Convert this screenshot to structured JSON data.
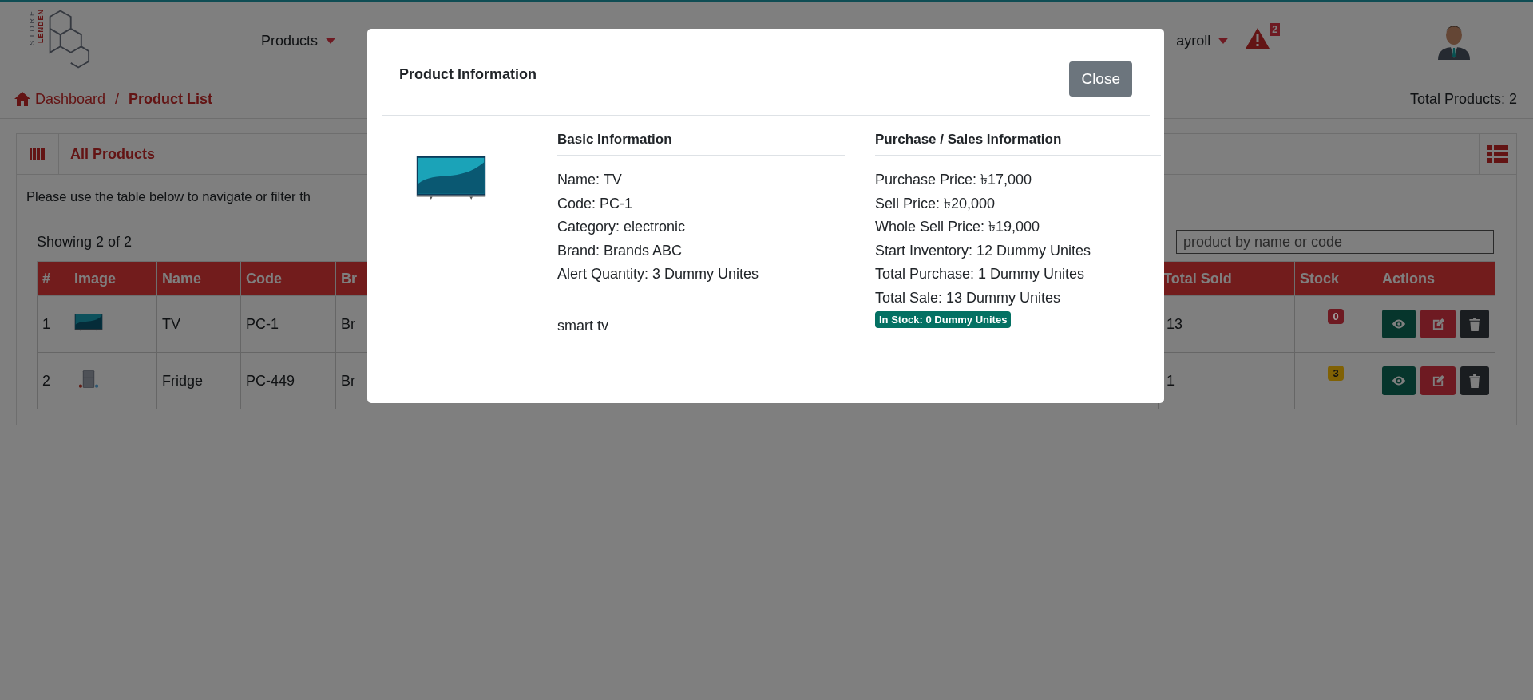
{
  "navbar": {
    "logo": {
      "line_1": "LENDEN",
      "line_2": "STORE"
    },
    "menus": [
      {
        "label": "Products"
      },
      {
        "label": "ayroll"
      }
    ],
    "alerts": {
      "count": "2"
    }
  },
  "breadcrumb": {
    "items": [
      {
        "label": "Dashboard",
        "current": false
      },
      {
        "label": "Product List",
        "current": true
      }
    ],
    "separator": "/"
  },
  "total_products": "Total Products: 2",
  "card": {
    "title": "All Products",
    "description": "Please use the table below to navigate or filter th",
    "showing": "Showing 2 of 2",
    "search": {
      "placeholder": "product by name or code"
    }
  },
  "table": {
    "columns": [
      "#",
      "Image",
      "Name",
      "Code",
      "Br",
      "Total Sold",
      "Stock",
      "Actions"
    ],
    "rows": [
      {
        "index": "1",
        "image": {
          "kind": "tv"
        },
        "name": "TV",
        "code": "PC-1",
        "column_5": "Br",
        "total_sold": "13",
        "stock": {
          "value": "0",
          "color": "#6e1a22"
        }
      },
      {
        "index": "2",
        "image": {
          "kind": "fridge"
        },
        "name": "Fridge",
        "code": "PC-449",
        "column_5": "Br",
        "total_sold": "1",
        "stock": {
          "value": "3",
          "color": "#806104"
        }
      }
    ]
  },
  "modal": {
    "title": "Product Information",
    "close_label": "Close",
    "image": {
      "kind": "tv"
    },
    "basic": {
      "heading": "Basic Information",
      "lines": [
        "Name: TV",
        "Code: PC-1",
        "Category: electronic",
        "Brand: Brands ABC",
        "Alert Quantity: 3 Dummy Unites"
      ],
      "note": "smart tv"
    },
    "sales": {
      "heading": "Purchase / Sales Information",
      "lines": [
        "Purchase Price: ৳17,000",
        "Sell Price: ৳20,000",
        "Whole Sell Price: ৳19,000",
        "Start Inventory: 12 Dummy Unites",
        "Total Purchase: 1 Dummy Unites",
        "Total Sale: 13 Dummy Unites"
      ],
      "stock_badge": "In Stock: 0 Dummy Unites"
    }
  }
}
